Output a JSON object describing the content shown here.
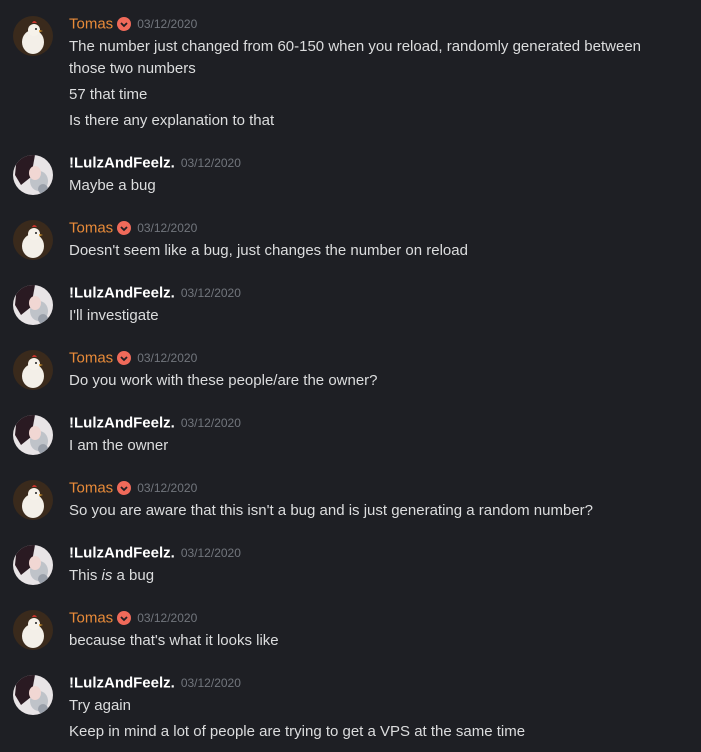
{
  "users": {
    "tomas": {
      "name": "Tomas",
      "color": "#e98b39",
      "badge": "heart-badge-icon"
    },
    "lulz": {
      "name": "!LulzAndFeelz.",
      "color": "#ffffff"
    }
  },
  "messages": [
    {
      "author": "Tomas",
      "timestamp": "03/12/2020",
      "lines": [
        "The number just changed from 60-150 when you reload, randomly generated between those two numbers",
        "57 that time",
        "Is there any explanation to that"
      ]
    },
    {
      "author": "!LulzAndFeelz.",
      "timestamp": "03/12/2020",
      "lines": [
        "Maybe a bug"
      ]
    },
    {
      "author": "Tomas",
      "timestamp": "03/12/2020",
      "lines": [
        "Doesn't seem like a bug, just changes the number on reload"
      ]
    },
    {
      "author": "!LulzAndFeelz.",
      "timestamp": "03/12/2020",
      "lines": [
        "I'll investigate"
      ]
    },
    {
      "author": "Tomas",
      "timestamp": "03/12/2020",
      "lines": [
        "Do you work with these people/are the owner?"
      ]
    },
    {
      "author": "!LulzAndFeelz.",
      "timestamp": "03/12/2020",
      "lines": [
        "I am the owner"
      ]
    },
    {
      "author": "Tomas",
      "timestamp": "03/12/2020",
      "lines": [
        "So you are aware that this isn't a bug and is just generating a random number?"
      ]
    },
    {
      "author": "!LulzAndFeelz.",
      "timestamp": "03/12/2020",
      "lines": [
        {
          "before": "This ",
          "emphasis": "is",
          "after": " a bug"
        }
      ]
    },
    {
      "author": "Tomas",
      "timestamp": "03/12/2020",
      "lines": [
        "because that's what it looks like"
      ]
    },
    {
      "author": "!LulzAndFeelz.",
      "timestamp": "03/12/2020",
      "lines": [
        "Try again",
        "Keep in mind a lot of people are trying to get a VPS at the same time"
      ]
    }
  ]
}
